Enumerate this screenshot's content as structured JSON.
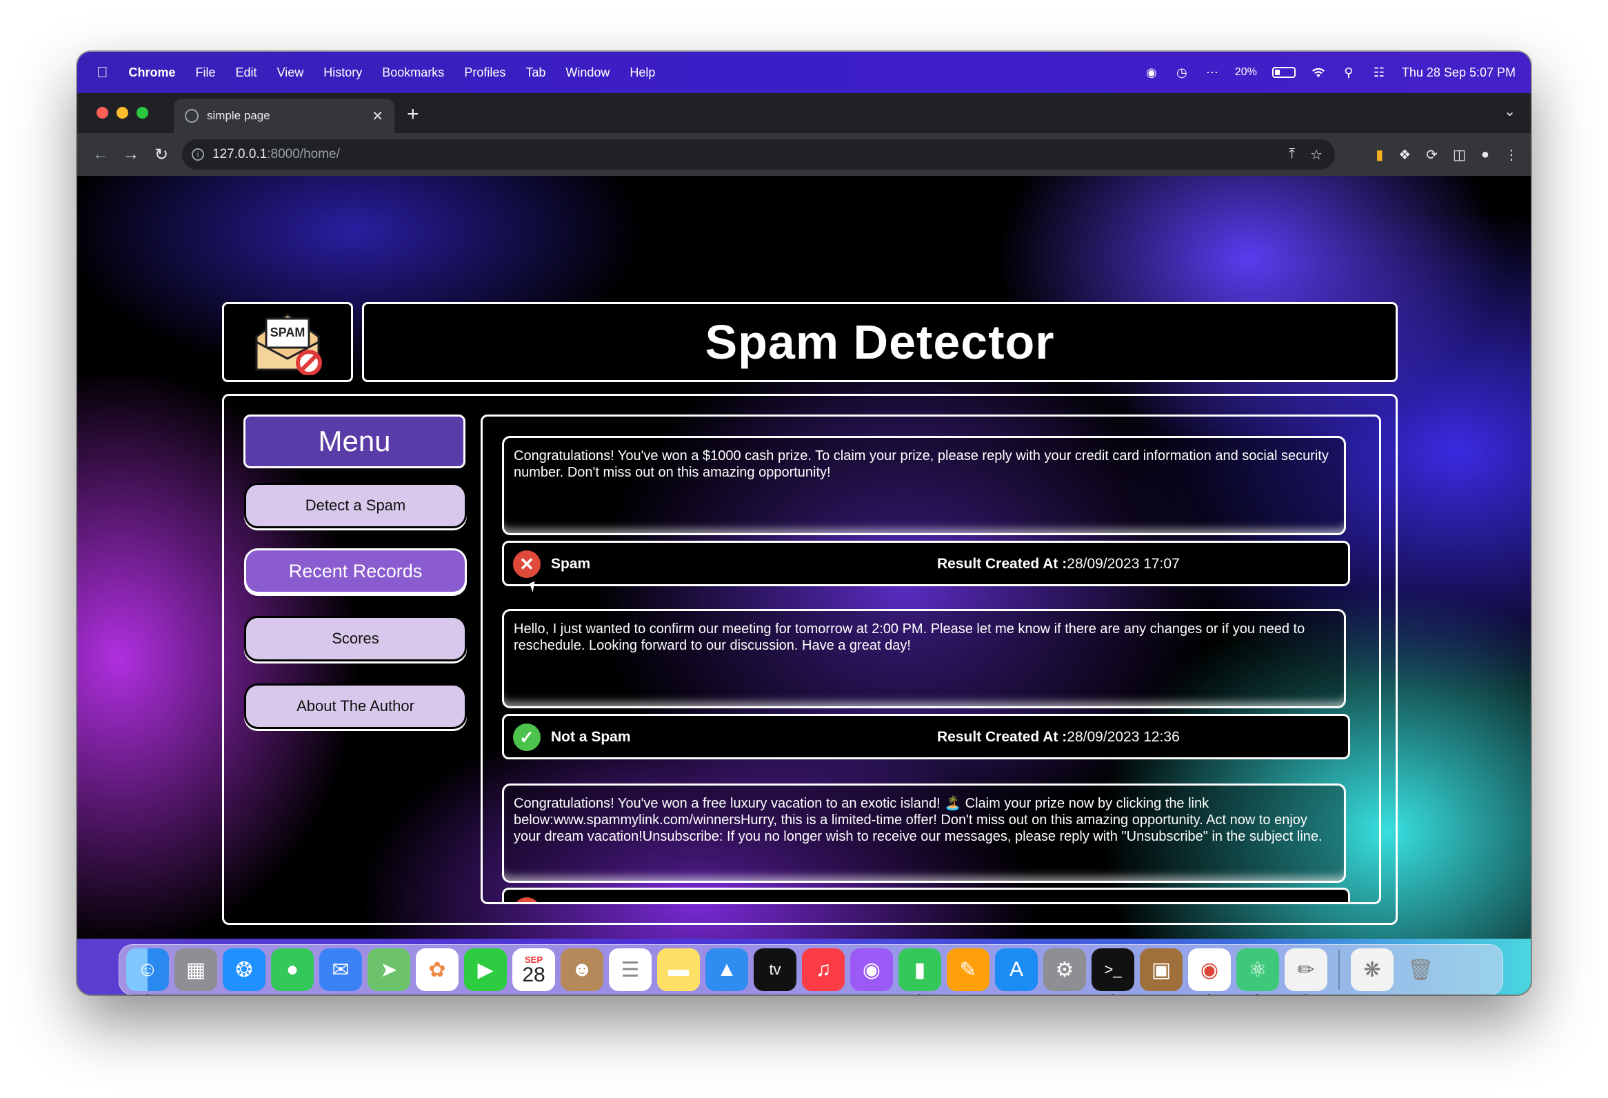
{
  "menubar": {
    "app": "Chrome",
    "items": [
      "File",
      "Edit",
      "View",
      "History",
      "Bookmarks",
      "Profiles",
      "Tab",
      "Window",
      "Help"
    ],
    "battery": "20%",
    "datetime": "Thu 28 Sep  5:07 PM"
  },
  "browser": {
    "tab_title": "simple page",
    "url_host": "127.0.0.1",
    "url_path": ":8000/home/"
  },
  "page": {
    "logo_text": "SPAM",
    "title": "Spam Detector",
    "menu": {
      "title": "Menu",
      "items": [
        {
          "label": "Detect a Spam"
        },
        {
          "label": "Recent Records",
          "active": true
        },
        {
          "label": "Scores"
        },
        {
          "label": "About The Author"
        }
      ]
    },
    "records": [
      {
        "message": "Congratulations! You've won a $1000 cash prize. To claim your prize, please reply with your credit card information and social security number. Don't miss out on this amazing opportunity!",
        "result": "Spam",
        "result_icon": "x-circle-icon",
        "created_label": "Result Created At :",
        "created_at": "28/09/2023 17:07"
      },
      {
        "message": "Hello, I just wanted to confirm our meeting for tomorrow at 2:00 PM. Please let me know if there are any changes or if you need to reschedule. Looking forward to our discussion. Have a great day!",
        "result": "Not a Spam",
        "result_icon": "check-circle-icon",
        "created_label": "Result Created At :",
        "created_at": "28/09/2023 12:36"
      },
      {
        "message": "Congratulations! You've won a free luxury vacation to an exotic island! 🏝️ Claim your prize now by clicking the link below:www.spammylink.com/winnersHurry, this is a limited-time offer! Don't miss out on this amazing opportunity. Act now to enjoy your dream vacation!Unsubscribe: If you no longer wish to receive our messages, please reply with \"Unsubscribe\" in the subject line."
      }
    ]
  },
  "colors": {
    "spam": "#e04a3a",
    "not_spam": "#4cc34c",
    "menu_title_bg": "#5a3ca8",
    "menu_active_bg": "#8a5cd0",
    "menu_button_bg": "#d8c8ec"
  },
  "dock": {
    "calendar_month": "SEP",
    "calendar_day": "28",
    "tv_label": "tv"
  }
}
